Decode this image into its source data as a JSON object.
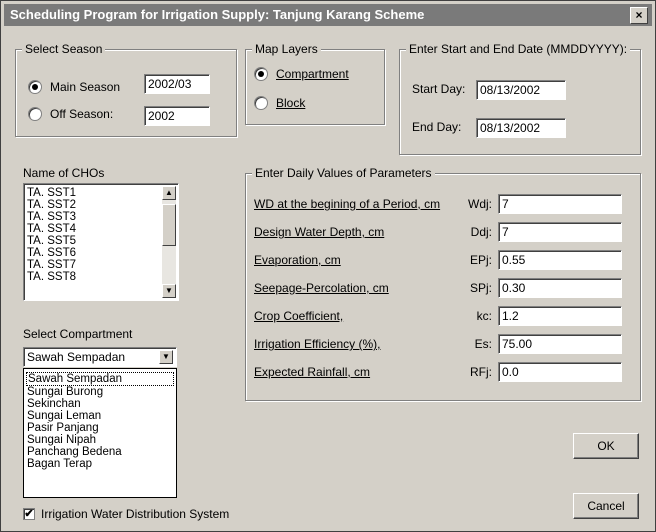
{
  "window": {
    "title": "Scheduling Program for Irrigation Supply: Tanjung Karang Scheme",
    "close": "×"
  },
  "season": {
    "legend": "Select Season",
    "main_label": "Main Season",
    "main_value": "2002/03",
    "off_label": "Off Season:",
    "off_value": "2002",
    "selected": "main"
  },
  "map_layers": {
    "legend": "Map Layers",
    "compartment": "Compartment",
    "block": "Block",
    "selected": "compartment"
  },
  "dates": {
    "legend": "Enter Start and End Date (MMDDYYYY):",
    "start_label": "Start Day:",
    "start_value": "08/13/2002",
    "end_label": "End Day:",
    "end_value": "08/13/2002"
  },
  "cho": {
    "label": "Name of CHOs",
    "items": [
      "TA. SST1",
      "TA. SST2",
      "TA. SST3",
      "TA. SST4",
      "TA. SST5",
      "TA. SST6",
      "TA. SST7",
      "TA. SST8"
    ]
  },
  "compartment": {
    "label": "Select Compartment",
    "selected": "Sawah Sempadan",
    "options": [
      "Sawah Sempadan",
      "Sungai Burong",
      "Sekinchan",
      "Sungai Leman",
      "Pasir Panjang",
      "Sungai Nipah",
      "Panchang Bedena",
      "Bagan Terap"
    ]
  },
  "params": {
    "legend": "Enter Daily Values of Parameters",
    "rows": [
      {
        "label": "WD at the begining of a Period, cm",
        "symbol": "Wdj:",
        "value": "7"
      },
      {
        "label": "Design Water Depth, cm",
        "symbol": "Ddj:",
        "value": "7"
      },
      {
        "label": "Evaporation, cm",
        "symbol": "EPj:",
        "value": "0.55"
      },
      {
        "label": "Seepage-Percolation, cm",
        "symbol": "SPj:",
        "value": "0.30"
      },
      {
        "label": "Crop Coefficient,",
        "symbol": "kc:",
        "value": "1.2"
      },
      {
        "label": "Irrigation Efficiency (%),",
        "symbol": "Es:",
        "value": "75.00"
      },
      {
        "label": "Expected Rainfall, cm",
        "symbol": "RFj:",
        "value": "0.0"
      }
    ]
  },
  "buttons": {
    "ok": "OK",
    "cancel": "Cancel"
  },
  "distribution": {
    "label": "Irrigation Water Distribution System",
    "checked": true,
    "mark": "✔"
  },
  "glyphs": {
    "up": "▲",
    "down": "▼"
  }
}
